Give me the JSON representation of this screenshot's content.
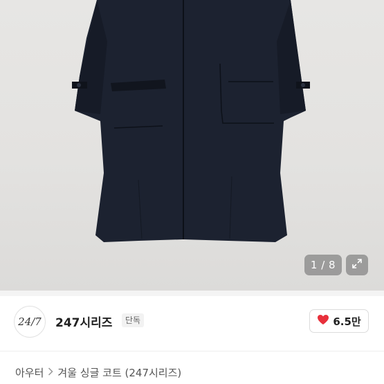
{
  "gallery": {
    "counter": "1 / 8",
    "image_icon": "expand-icon"
  },
  "shop": {
    "logo_text": "24/7",
    "name": "247시리즈",
    "badge": "단독",
    "like": {
      "icon": "heart-icon",
      "count": "6.5만",
      "heart_color": "#e8303b"
    }
  },
  "breadcrumb": {
    "items": [
      "아우터",
      "겨울 싱글 코트 (247시리즈)"
    ],
    "separator_icon": "chevron-right-icon"
  }
}
